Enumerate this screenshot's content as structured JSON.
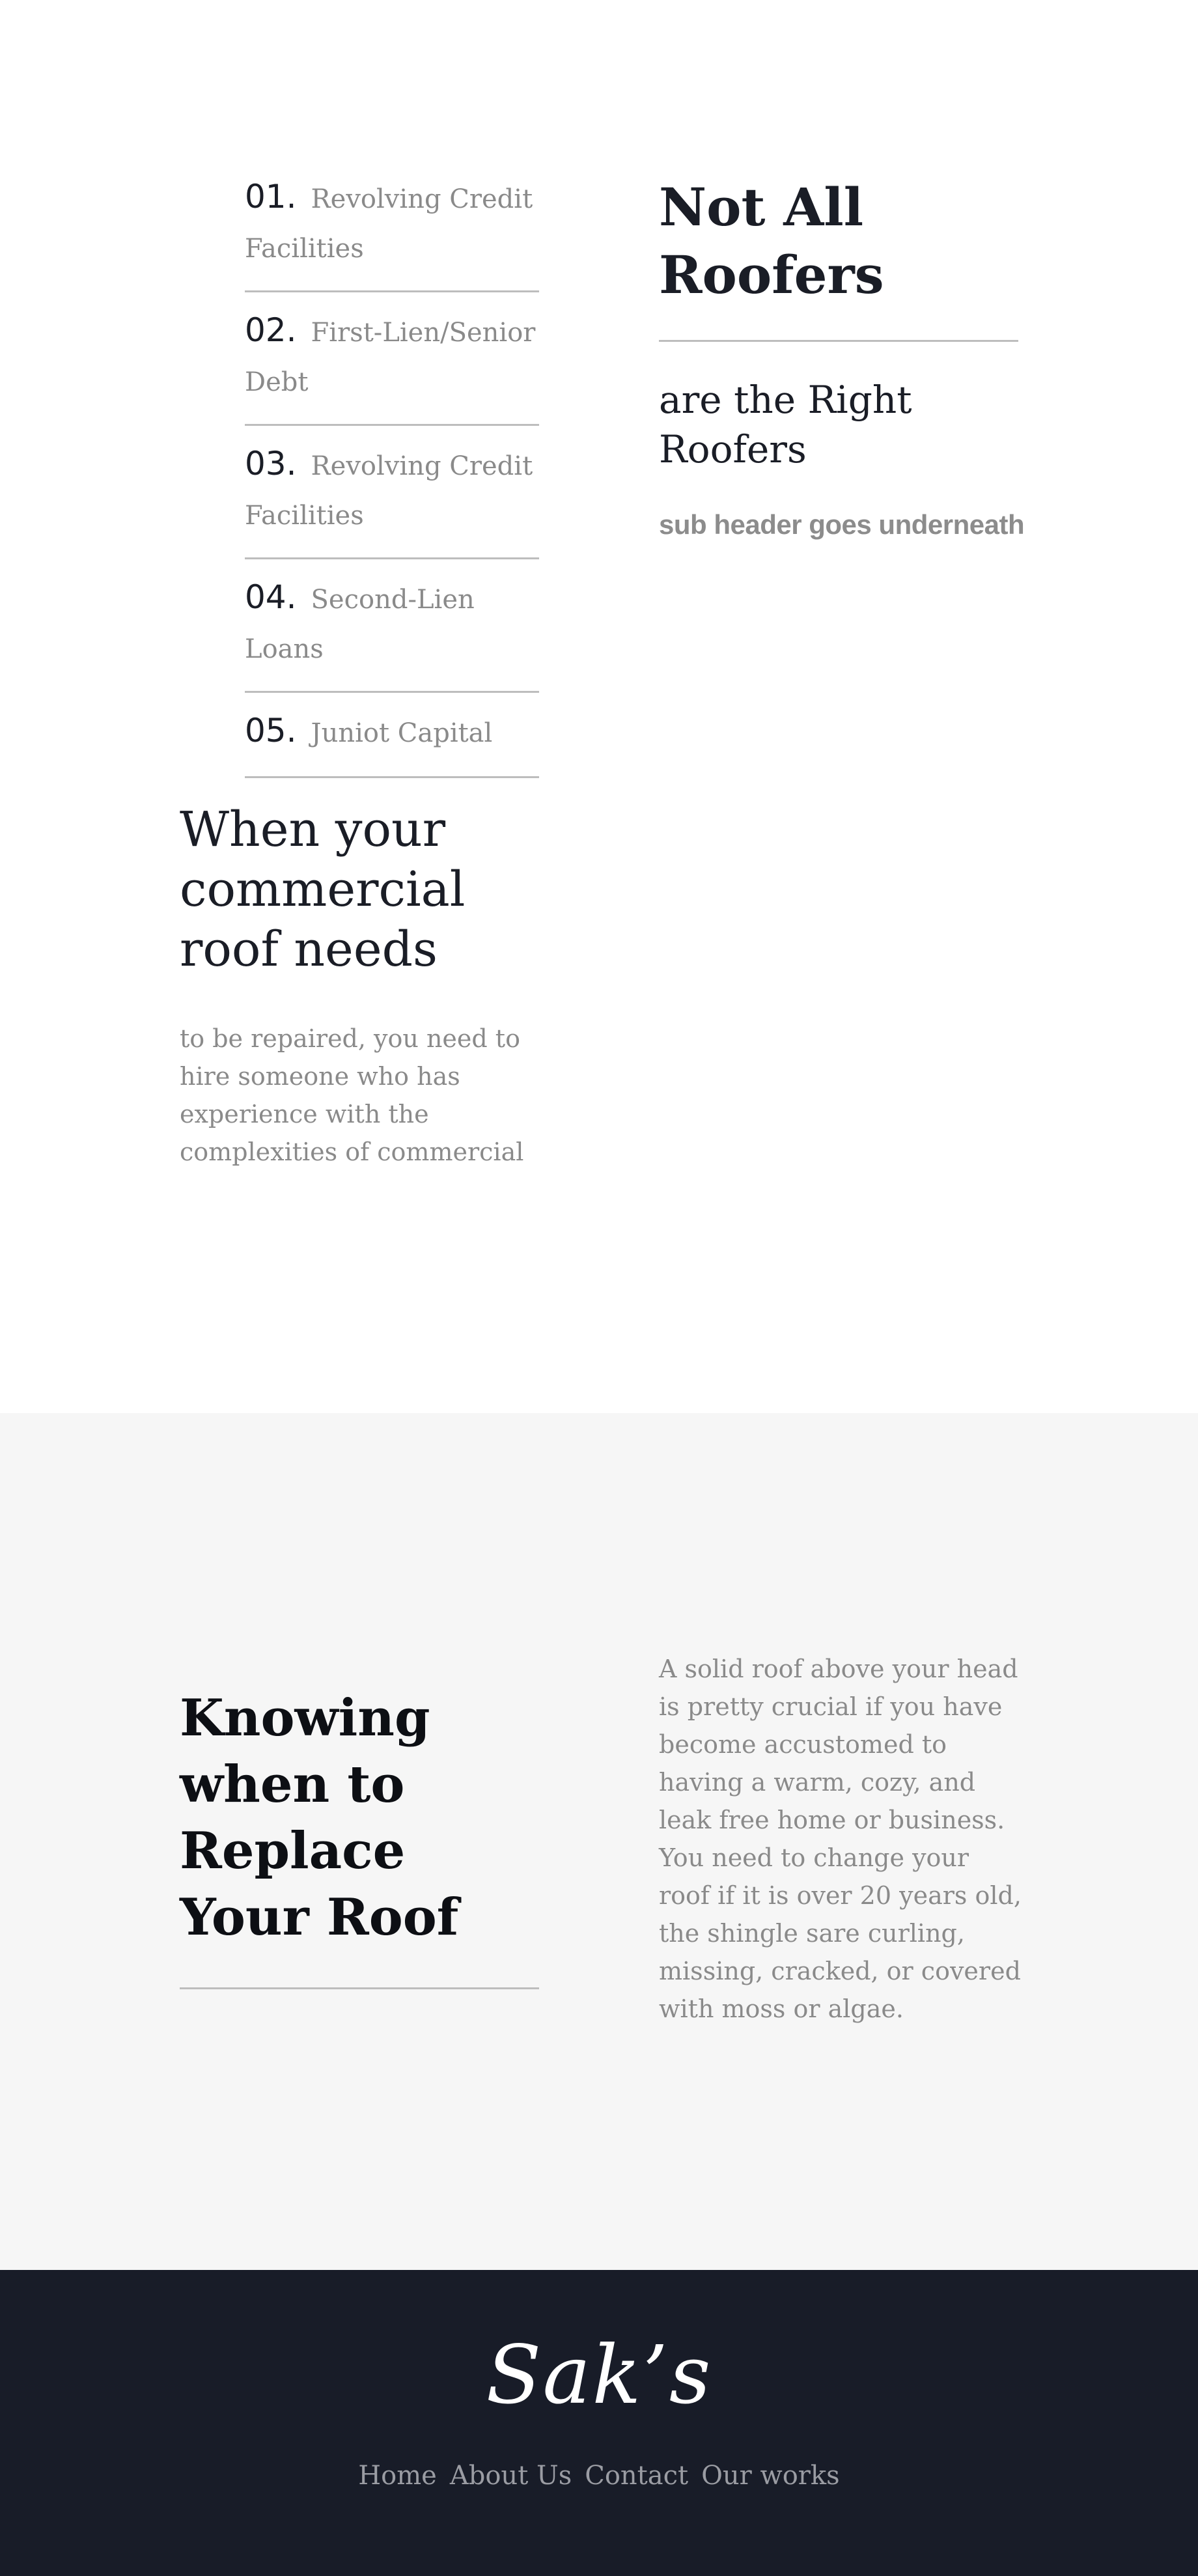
{
  "services_list": [
    {
      "index": "01.",
      "label": "Revolving Credit Facilities"
    },
    {
      "index": "02.",
      "label": "First-Lien/Senior Debt"
    },
    {
      "index": "03.",
      "label": "Revolving Credit Facilities"
    },
    {
      "index": "04.",
      "label": "Second-Lien Loans"
    },
    {
      "index": "05.",
      "label": "Juniot Capital"
    }
  ],
  "intro": {
    "heading": "When your commercial roof needs",
    "paragraph": "to be repaired, you need to hire someone who has experience with the complexities of commercial"
  },
  "hero": {
    "heading": "Not All Roofers",
    "subheading": "are the Right Roofers",
    "subheader_note": "sub header goes underneath"
  },
  "replace_section": {
    "heading": "Knowing when to Replace Your Roof",
    "paragraph": "A solid roof above your head is pretty crucial if you have become accustomed to having a warm, cozy, and leak free home or business. You need to change your roof if it is over 20 years old, the shingle sare curling, missing, cracked, or covered with moss or algae."
  },
  "footer": {
    "logo": "Sak’s",
    "nav": [
      "Home",
      "About Us",
      "Contact",
      "Our works"
    ]
  },
  "colors": {
    "footer_bg": "#181c28",
    "mid_section_bg": "#f6f6f6",
    "text_dark": "#1a1d26",
    "text_muted": "#8a8a8a",
    "divider": "#bdbdbd"
  }
}
